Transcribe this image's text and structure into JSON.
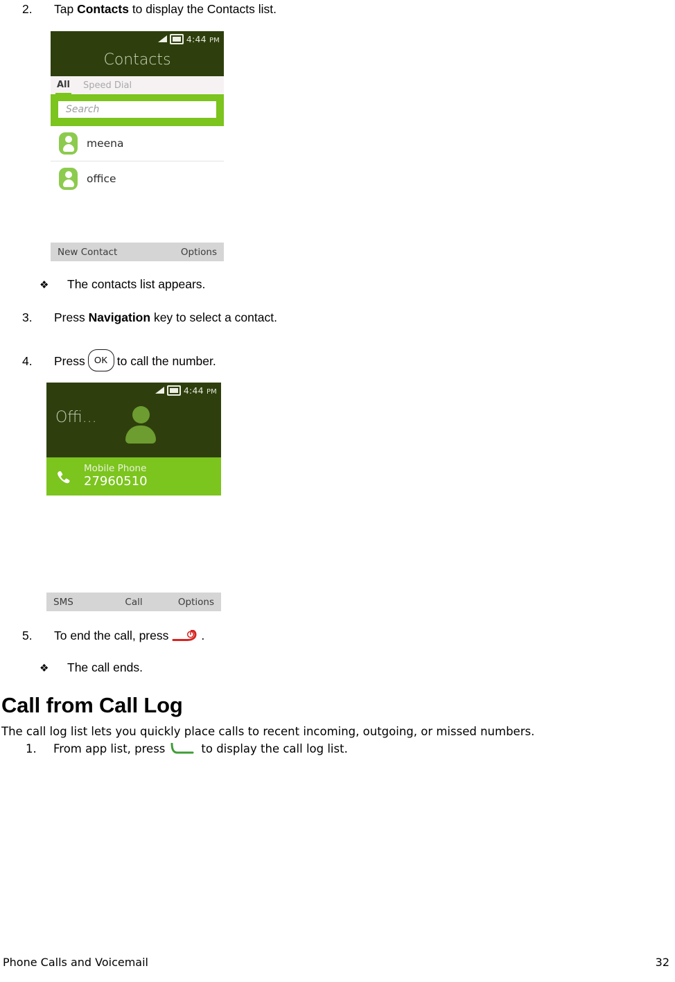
{
  "document": {
    "footer": {
      "section": "Phone Calls and Voicemail",
      "page_number": "32"
    }
  },
  "steps": {
    "step2": {
      "number": "2.",
      "text_before": "Tap ",
      "bold": "Contacts",
      "text_after": " to display the Contacts list."
    },
    "result1": {
      "glyph": "❖",
      "text": "The contacts list appears."
    },
    "step3": {
      "number": "3.",
      "text_before": "Press ",
      "bold": "Navigation",
      "text_after": " key to select a contact."
    },
    "step4": {
      "number": "4.",
      "text_before": "Press",
      "key_label": "OK",
      "text_after": "to call the number."
    },
    "step5": {
      "number": "5.",
      "text_before": "To end the call, press",
      "text_after": "."
    },
    "result2": {
      "glyph": "❖",
      "text": "The call ends."
    },
    "step_log_1": {
      "number": "1.",
      "text_before": "From app list, press",
      "text_after": "to display the call log list."
    }
  },
  "heading": {
    "title": "Call from Call Log",
    "intro": "The call log list lets you quickly place calls to recent incoming, outgoing, or missed numbers."
  },
  "phone_contacts": {
    "status": {
      "time": "4:44",
      "ampm": "PM",
      "signal_icon": "signal-bars-icon",
      "battery_icon": "battery-icon"
    },
    "title": "Contacts",
    "tabs": [
      {
        "label": "All",
        "active": true
      },
      {
        "label": "Speed Dial",
        "active": false
      }
    ],
    "search_placeholder": "Search",
    "contacts": [
      {
        "name": "meena",
        "avatar_icon": "person-avatar-icon"
      },
      {
        "name": "office",
        "avatar_icon": "person-avatar-icon"
      }
    ],
    "softkeys": {
      "left": "New Contact",
      "right": "Options"
    },
    "colors": {
      "header": "#2e3f0d",
      "accent_green": "#7cc41e",
      "avatar_green": "#8ccb4e",
      "softkey_bar": "#d5d5d5",
      "tab_bar": "#f6f2f3"
    }
  },
  "phone_detail": {
    "status": {
      "time": "4:44",
      "ampm": "PM",
      "signal_icon": "signal-bars-icon",
      "battery_icon": "battery-icon"
    },
    "contact_name": "Offi...",
    "avatar_icon": "large-person-icon",
    "phone_entry": {
      "type_label": "Mobile Phone",
      "number": "27960510",
      "icon": "phone-handset-icon"
    },
    "softkeys": {
      "left": "SMS",
      "center": "Call",
      "right": "Options"
    },
    "colors": {
      "header": "#2e3f0d",
      "accent_green": "#7cc41e",
      "person_green": "#6d9c30",
      "softkey_bar": "#d5d5d5"
    }
  },
  "icons": {
    "end_call_color": "#d8231f",
    "send_call_color": "#3f9c35"
  }
}
